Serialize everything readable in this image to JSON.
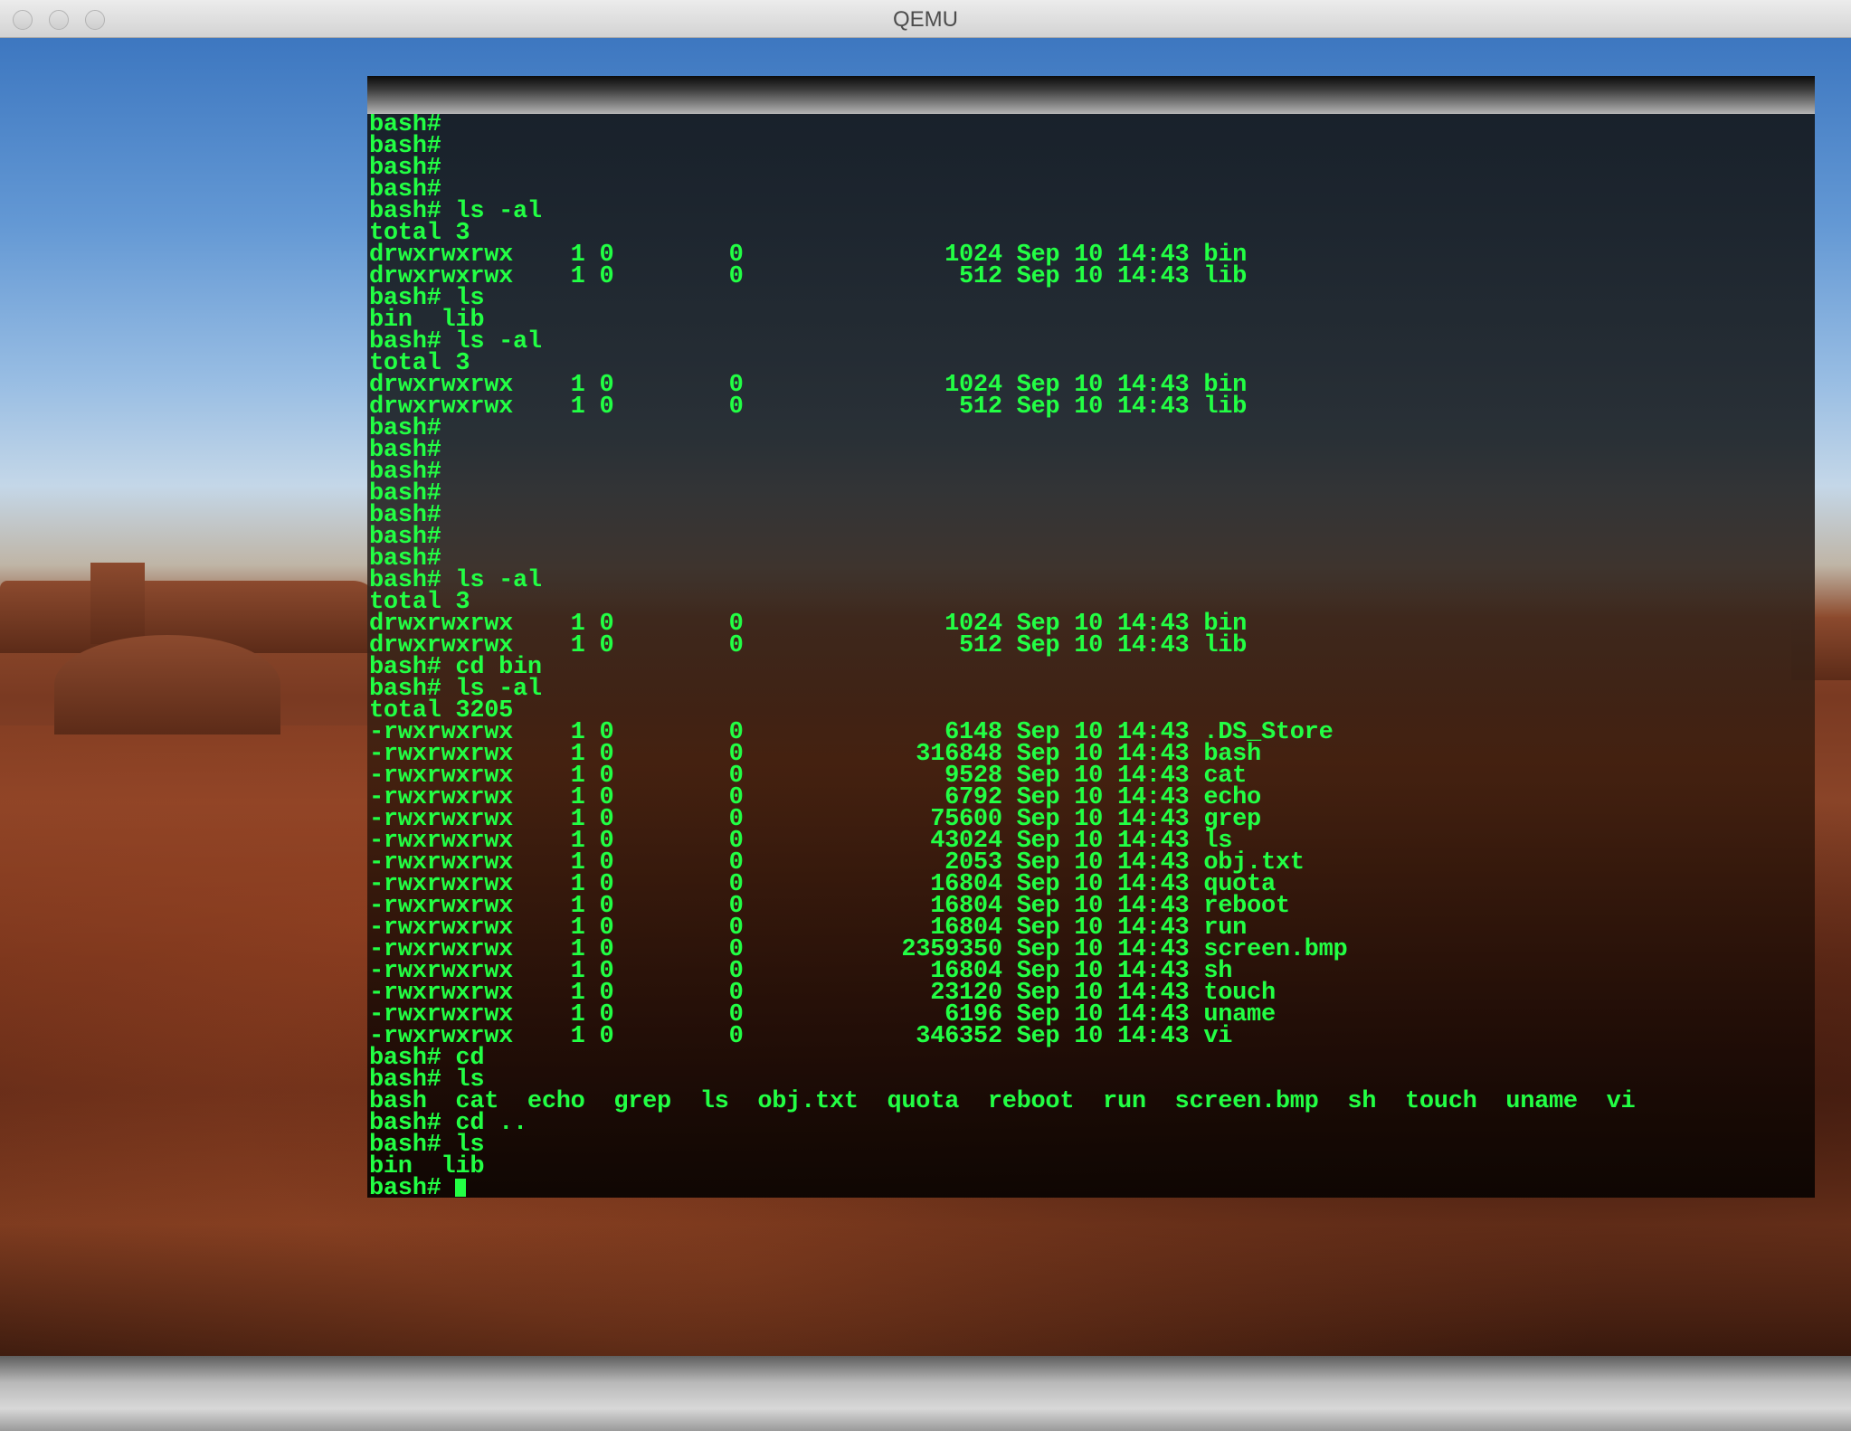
{
  "window": {
    "title": "QEMU"
  },
  "terminal": {
    "lines": [
      "bash#",
      "bash#",
      "bash#",
      "bash#",
      "bash# ls -al",
      "total 3",
      "drwxrwxrwx    1 0        0              1024 Sep 10 14:43 bin",
      "drwxrwxrwx    1 0        0               512 Sep 10 14:43 lib",
      "bash# ls",
      "bin  lib",
      "bash# ls -al",
      "total 3",
      "drwxrwxrwx    1 0        0              1024 Sep 10 14:43 bin",
      "drwxrwxrwx    1 0        0               512 Sep 10 14:43 lib",
      "bash#",
      "bash#",
      "bash#",
      "bash#",
      "bash#",
      "bash#",
      "bash#",
      "bash# ls -al",
      "total 3",
      "drwxrwxrwx    1 0        0              1024 Sep 10 14:43 bin",
      "drwxrwxrwx    1 0        0               512 Sep 10 14:43 lib",
      "bash# cd bin",
      "bash# ls -al",
      "total 3205",
      "-rwxrwxrwx    1 0        0              6148 Sep 10 14:43 .DS_Store",
      "-rwxrwxrwx    1 0        0            316848 Sep 10 14:43 bash",
      "-rwxrwxrwx    1 0        0              9528 Sep 10 14:43 cat",
      "-rwxrwxrwx    1 0        0              6792 Sep 10 14:43 echo",
      "-rwxrwxrwx    1 0        0             75600 Sep 10 14:43 grep",
      "-rwxrwxrwx    1 0        0             43024 Sep 10 14:43 ls",
      "-rwxrwxrwx    1 0        0              2053 Sep 10 14:43 obj.txt",
      "-rwxrwxrwx    1 0        0             16804 Sep 10 14:43 quota",
      "-rwxrwxrwx    1 0        0             16804 Sep 10 14:43 reboot",
      "-rwxrwxrwx    1 0        0             16804 Sep 10 14:43 run",
      "-rwxrwxrwx    1 0        0           2359350 Sep 10 14:43 screen.bmp",
      "-rwxrwxrwx    1 0        0             16804 Sep 10 14:43 sh",
      "-rwxrwxrwx    1 0        0             23120 Sep 10 14:43 touch",
      "-rwxrwxrwx    1 0        0              6196 Sep 10 14:43 uname",
      "-rwxrwxrwx    1 0        0            346352 Sep 10 14:43 vi",
      "bash# cd",
      "bash# ls",
      "bash  cat  echo  grep  ls  obj.txt  quota  reboot  run  screen.bmp  sh  touch  uname  vi",
      "bash# cd ..",
      "bash# ls",
      "bin  lib"
    ],
    "prompt": "bash# ",
    "text_color": "#22ff44"
  },
  "icons": {
    "close": "close-icon",
    "minimize": "minimize-icon",
    "zoom": "zoom-icon",
    "cursor": "text-cursor"
  }
}
